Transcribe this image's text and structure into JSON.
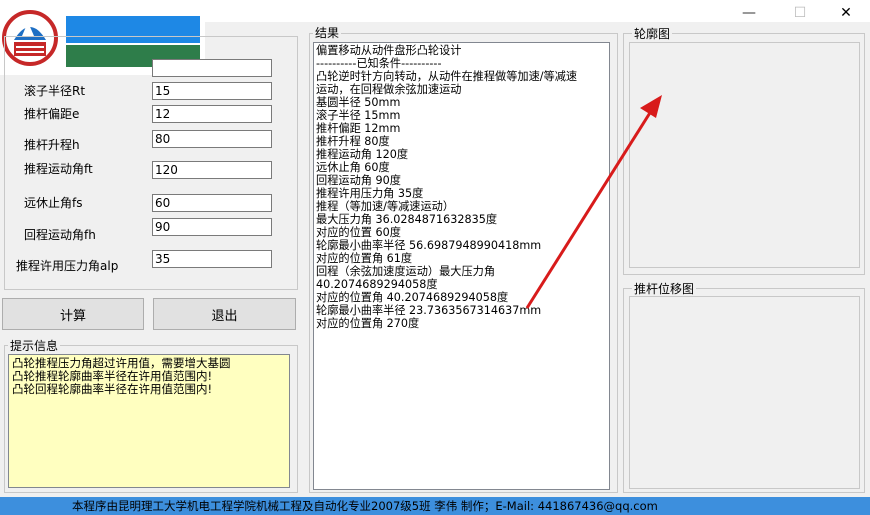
{
  "window": {
    "controls": [
      "—",
      "☐",
      "✕"
    ]
  },
  "inputs": [
    {
      "label": "滚子半径Rt",
      "value": "15"
    },
    {
      "label": "推杆偏距e",
      "value": "12"
    },
    {
      "label": "推杆升程h",
      "value": "80"
    },
    {
      "label": "推程运动角ft",
      "value": "120"
    },
    {
      "label": "远休止角fs",
      "value": "60"
    },
    {
      "label": "回程运动角fh",
      "value": "90"
    },
    {
      "label": "推程许用压力角alp",
      "value": "35"
    }
  ],
  "buttons": {
    "calculate": "计算",
    "exit": "退出"
  },
  "tips": {
    "title": "提示信息",
    "lines": [
      "凸轮推程压力角超过许用值，需要增大基圆",
      "凸轮推程轮廓曲率半径在许用值范围内!",
      "凸轮回程轮廓曲率半径在许用值范围内!"
    ]
  },
  "results": {
    "title": "结果",
    "lines": [
      "偏置移动从动件盘形凸轮设计",
      "----------已知条件----------",
      "凸轮逆时针方向转动，从动件在推程做等加速/等减速",
      "运动，在回程做余弦加速运动",
      "基圆半径   50mm",
      "滚子半径   15mm",
      "推杆偏距   12mm",
      "推杆升程   80度",
      "推程运动角  120度",
      "远休止角   60度",
      "回程运动角  90度",
      "推程许用压力角 35度",
      "推程（等加速/等减速运动）",
      "最大压力角    36.0284871632835度",
      "对应的位置    60度",
      "轮廓最小曲率半径  56.6987948990418mm",
      "对应的位置角  61度",
      " 回程（余弦加速度运动）最大压力角",
      "40.2074689294058度",
      "对应的位置角  40.2074689294058度",
      "轮廓最小曲率半径  23.7363567314637mm",
      "对应的位置角  270度"
    ]
  },
  "profile": {
    "title": "轮廓图"
  },
  "displacement": {
    "title": "推杆位移图"
  },
  "status": {
    "text": "本程序由昆明理工大学机电工程学院机械工程及自动化专业2007级5班  李伟  制作；E-Mail: 441867436@qq.com"
  },
  "colors": {
    "logo_blue": "#1e88e5",
    "logo_green": "#2e7d4a",
    "tip_bg": "#ffffc0",
    "status_bar": "#3d8fdd",
    "annotation_arrow": "#d81b1b"
  }
}
